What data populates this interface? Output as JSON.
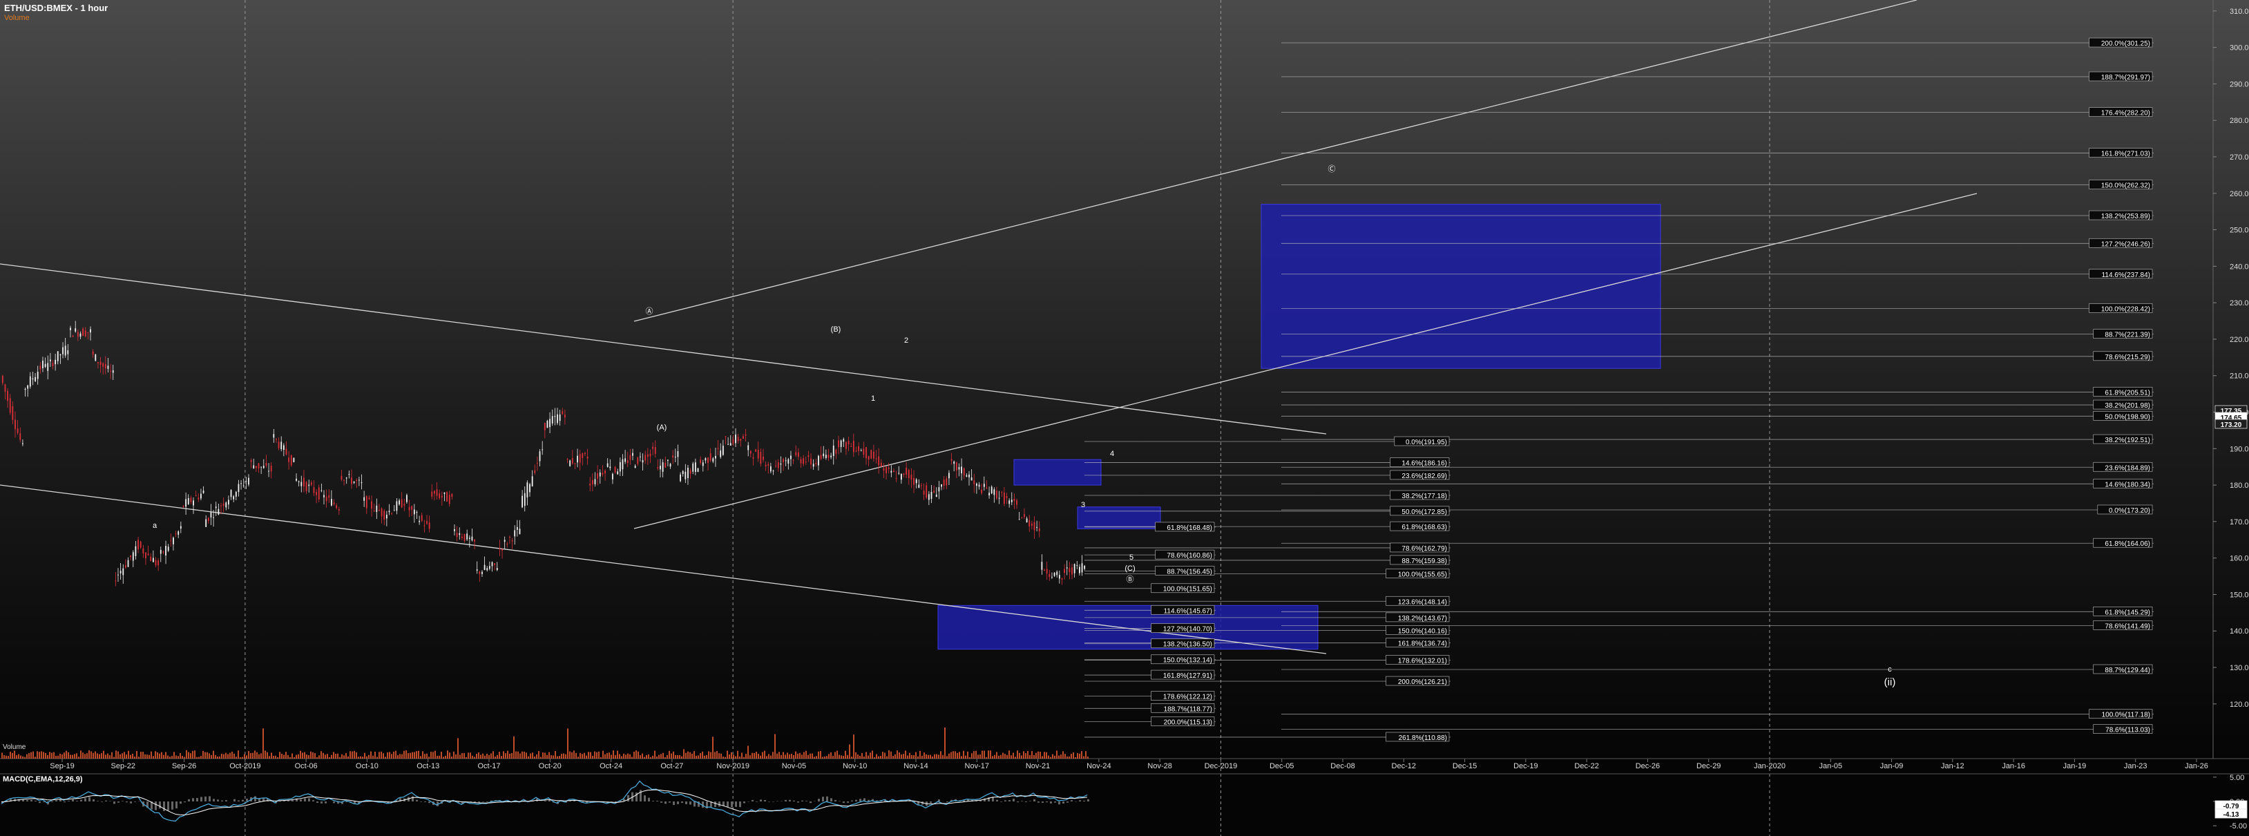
{
  "header": {
    "title": "ETH/USD:BMEX - 1 hour",
    "subtitle": "Volume"
  },
  "volume_label": "Volume",
  "macd_label": "MACD(C,EMA,12,26,9)",
  "colors": {
    "background": "#000000",
    "up_candle": "#f4f4f4",
    "down_candle": "#e0303a",
    "fib_line": "#bfbfbf",
    "box_fill": "#1e1ea8",
    "box_fill_light": "#3a3ad0",
    "current_price": "#ffffff",
    "volume": "#e05a30",
    "macd": "#4aa8d8",
    "signal": "#ffffff"
  },
  "chart_data": {
    "type": "candlestick",
    "symbol": "ETH/USD:BMEX",
    "interval": "1 hour",
    "ylim": [
      105,
      313
    ],
    "x_ticks": [
      "Sep-19",
      "Sep-22",
      "Sep-26",
      "Oct-2019",
      "Oct-06",
      "Oct-10",
      "Oct-13",
      "Oct-17",
      "Oct-20",
      "Oct-24",
      "Oct-27",
      "Nov-2019",
      "Nov-05",
      "Nov-10",
      "Nov-14",
      "Nov-17",
      "Nov-21",
      "Nov-24",
      "Nov-28",
      "Dec-2019",
      "Dec-05",
      "Dec-08",
      "Dec-12",
      "Dec-15",
      "Dec-19",
      "Dec-22",
      "Dec-26",
      "Dec-29",
      "Jan-2020",
      "Jan-05",
      "Jan-09",
      "Jan-12",
      "Jan-16",
      "Jan-19",
      "Jan-23",
      "Jan-26"
    ],
    "y_ticks": [
      120,
      130,
      140,
      150,
      160,
      170,
      180,
      190,
      200,
      210,
      220,
      230,
      240,
      250,
      260,
      270,
      280,
      290,
      300,
      310
    ],
    "price_path": [
      [
        210,
        190
      ],
      [
        206,
        214
      ],
      [
        212,
        218
      ],
      [
        222,
        222
      ],
      [
        216,
        210
      ],
      [
        154,
        162
      ],
      [
        164,
        158
      ],
      [
        160,
        168
      ],
      [
        174,
        178
      ],
      [
        170,
        176
      ],
      [
        176,
        182
      ],
      [
        186,
        184
      ],
      [
        194,
        186
      ],
      [
        182,
        178
      ],
      [
        178,
        174
      ],
      [
        183,
        180
      ],
      [
        176,
        172
      ],
      [
        172,
        176
      ],
      [
        174,
        168
      ],
      [
        178,
        176
      ],
      [
        168,
        164
      ],
      [
        156,
        158
      ],
      [
        162,
        168
      ],
      [
        174,
        190
      ],
      [
        196,
        200
      ],
      [
        186,
        188
      ],
      [
        180,
        186
      ],
      [
        183,
        188
      ],
      [
        186,
        190
      ],
      [
        184,
        188
      ],
      [
        182,
        186
      ],
      [
        186,
        190
      ],
      [
        192,
        193
      ],
      [
        190,
        186
      ],
      [
        184,
        188
      ],
      [
        188,
        186
      ],
      [
        186,
        190
      ],
      [
        192,
        190
      ],
      [
        190,
        186
      ],
      [
        184,
        182
      ],
      [
        184,
        178
      ],
      [
        176,
        182
      ],
      [
        186,
        182
      ],
      [
        180,
        178
      ],
      [
        178,
        174
      ],
      [
        172,
        168
      ],
      [
        158,
        154
      ],
      [
        156,
        158
      ]
    ],
    "current_price": "174.65",
    "price_badges": [
      "177.35",
      "174.65",
      "173.20"
    ],
    "fib_levels": [
      {
        "label": "200.0%(301.25)",
        "price": 301.25,
        "col": "A"
      },
      {
        "label": "188.7%(291.97)",
        "price": 291.97,
        "col": "A"
      },
      {
        "label": "176.4%(282.20)",
        "price": 282.2,
        "col": "A"
      },
      {
        "label": "161.8%(271.03)",
        "price": 271.03,
        "col": "A"
      },
      {
        "label": "150.0%(262.32)",
        "price": 262.32,
        "col": "A"
      },
      {
        "label": "138.2%(253.89)",
        "price": 253.89,
        "col": "A"
      },
      {
        "label": "127.2%(246.26)",
        "price": 246.26,
        "col": "A"
      },
      {
        "label": "114.6%(237.84)",
        "price": 237.84,
        "col": "A"
      },
      {
        "label": "100.0%(228.42)",
        "price": 228.42,
        "col": "A"
      },
      {
        "label": "88.7%(221.39)",
        "price": 221.39,
        "col": "A"
      },
      {
        "label": "78.6%(215.29)",
        "price": 215.29,
        "col": "A"
      },
      {
        "label": "61.8%(205.51)",
        "price": 205.51,
        "col": "A"
      },
      {
        "label": "38.2%(201.98)",
        "price": 201.98,
        "col": "A"
      },
      {
        "label": "50.0%(198.90)",
        "price": 198.9,
        "col": "A"
      },
      {
        "label": "38.2%(192.51)",
        "price": 192.51,
        "col": "A"
      },
      {
        "label": "23.6%(184.89)",
        "price": 184.89,
        "col": "A"
      },
      {
        "label": "14.6%(180.34)",
        "price": 180.34,
        "col": "A"
      },
      {
        "label": "0.0%(173.20)",
        "price": 173.2,
        "col": "A"
      },
      {
        "label": "61.8%(164.06)",
        "price": 164.06,
        "col": "A"
      },
      {
        "label": "61.8%(145.29)",
        "price": 145.29,
        "col": "A"
      },
      {
        "label": "78.6%(141.49)",
        "price": 141.49,
        "col": "A"
      },
      {
        "label": "88.7%(129.44)",
        "price": 129.44,
        "col": "A"
      },
      {
        "label": "100.0%(117.18)",
        "price": 117.18,
        "col": "A"
      },
      {
        "label": "78.6%(113.03)",
        "price": 113.03,
        "col": "A"
      },
      {
        "label": "0.0%(191.95)",
        "price": 191.95,
        "col": "B"
      },
      {
        "label": "14.6%(186.16)",
        "price": 186.16,
        "col": "B"
      },
      {
        "label": "23.6%(182.69)",
        "price": 182.69,
        "col": "B"
      },
      {
        "label": "38.2%(177.18)",
        "price": 177.18,
        "col": "B"
      },
      {
        "label": "50.0%(172.85)",
        "price": 172.85,
        "col": "B"
      },
      {
        "label": "61.8%(168.63)",
        "price": 168.63,
        "col": "B"
      },
      {
        "label": "78.6%(162.79)",
        "price": 162.79,
        "col": "B"
      },
      {
        "label": "88.7%(159.38)",
        "price": 159.38,
        "col": "B"
      },
      {
        "label": "100.0%(155.65)",
        "price": 155.65,
        "col": "B"
      },
      {
        "label": "123.6%(148.14)",
        "price": 148.14,
        "col": "B"
      },
      {
        "label": "138.2%(143.67)",
        "price": 143.67,
        "col": "B"
      },
      {
        "label": "150.0%(140.16)",
        "price": 140.16,
        "col": "B"
      },
      {
        "label": "161.8%(136.74)",
        "price": 136.74,
        "col": "B"
      },
      {
        "label": "178.6%(132.01)",
        "price": 132.01,
        "col": "B"
      },
      {
        "label": "200.0%(126.21)",
        "price": 126.21,
        "col": "B"
      },
      {
        "label": "261.8%(110.88)",
        "price": 110.88,
        "col": "B"
      },
      {
        "label": "61.8%(168.48)",
        "price": 168.48,
        "col": "C"
      },
      {
        "label": "78.6%(160.86)",
        "price": 160.86,
        "col": "C"
      },
      {
        "label": "88.7%(156.45)",
        "price": 156.45,
        "col": "C"
      },
      {
        "label": "100.0%(151.65)",
        "price": 151.65,
        "col": "C"
      },
      {
        "label": "114.6%(145.67)",
        "price": 145.67,
        "col": "C"
      },
      {
        "label": "127.2%(140.70)",
        "price": 140.7,
        "col": "C"
      },
      {
        "label": "138.2%(136.50)",
        "price": 136.5,
        "col": "C"
      },
      {
        "label": "150.0%(132.14)",
        "price": 132.14,
        "col": "C"
      },
      {
        "label": "161.8%(127.91)",
        "price": 127.91,
        "col": "C"
      },
      {
        "label": "178.6%(122.12)",
        "price": 122.12,
        "col": "C"
      },
      {
        "label": "188.7%(118.77)",
        "price": 118.77,
        "col": "C"
      },
      {
        "label": "200.0%(115.13)",
        "price": 115.13,
        "col": "C"
      }
    ],
    "target_zones": [
      {
        "name": "upper-target",
        "from_price": 212,
        "to_price": 257
      },
      {
        "name": "lower-target",
        "from_price": 135,
        "to_price": 147
      },
      {
        "name": "resistance-zone",
        "from_price": 180,
        "to_price": 187
      },
      {
        "name": "support-zone",
        "from_price": 168,
        "to_price": 174
      }
    ],
    "wave_labels": [
      "a",
      "Ⓐ",
      "(A)",
      "(B)",
      "1",
      "2",
      "3",
      "4",
      "5",
      "(C)",
      "Ⓑ",
      "Ⓒ",
      "c",
      "(ii)"
    ],
    "macd": {
      "name": "MACD(C,EMA,12,26,9)",
      "ticks": [
        "5.00",
        "0.00",
        "-5.00"
      ],
      "last_values": [
        "-0.79",
        "-4.13"
      ]
    }
  }
}
